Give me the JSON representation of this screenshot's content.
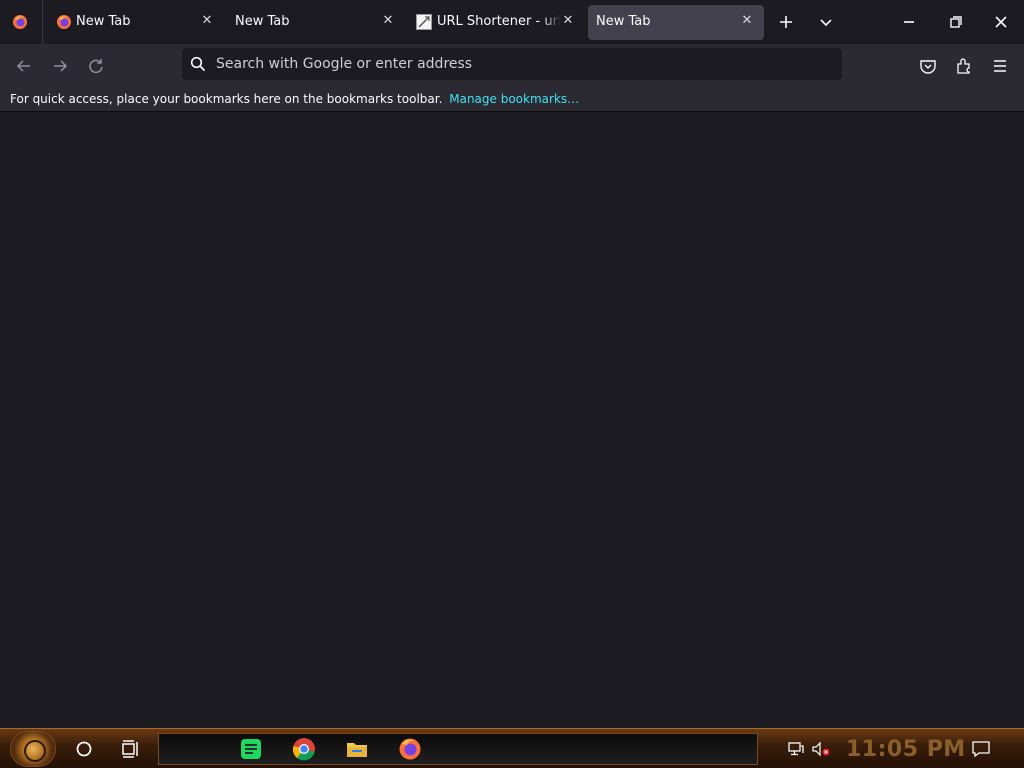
{
  "browser": {
    "tabs": [
      {
        "title": "New Tab",
        "icon": "firefox-icon",
        "selected": false
      },
      {
        "title": "New Tab",
        "icon": "",
        "selected": false
      },
      {
        "title": "URL Shortener - url s",
        "icon": "site-favicon",
        "selected": false
      },
      {
        "title": "New Tab",
        "icon": "",
        "selected": true
      }
    ],
    "new_tab_icon": "plus-icon",
    "list_tabs_icon": "chevron-down-icon",
    "window_controls": [
      "minimize-icon",
      "restore-icon",
      "close-icon"
    ]
  },
  "navbar": {
    "back_icon": "arrow-left-icon",
    "forward_icon": "arrow-right-icon",
    "reload_icon": "reload-icon",
    "url_placeholder": "Search with Google or enter address",
    "right_icons": [
      "pocket-icon",
      "extensions-icon",
      "menu-icon"
    ]
  },
  "bookmarks_toolbar": {
    "message": "For quick access, place your bookmarks here on the bookmarks toolbar.",
    "link": "Manage bookmarks…"
  },
  "taskbar": {
    "clock": "11:05 PM",
    "apps": [
      "chat-app-icon",
      "chrome-icon",
      "file-explorer-icon",
      "firefox-icon"
    ],
    "tray_icons": [
      "network-icon",
      "volume-muted-icon",
      "notifications-icon"
    ]
  },
  "colors": {
    "accent_link": "#3fe1ee",
    "tab_selected": "#42414d",
    "toolbar": "#2b2a33",
    "content": "#1c1b22"
  }
}
